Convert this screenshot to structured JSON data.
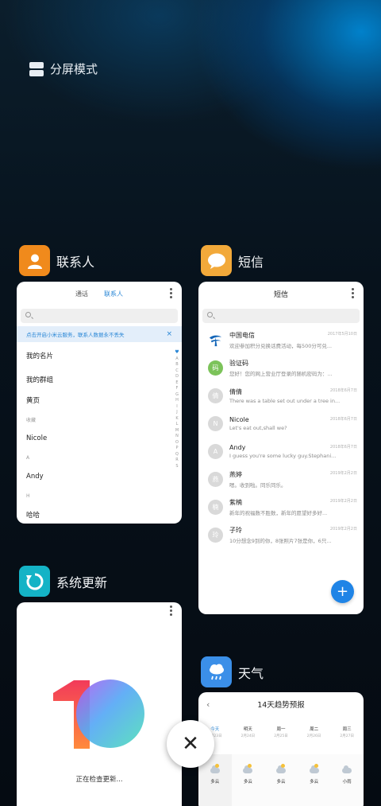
{
  "split_mode": {
    "label": "分屏模式"
  },
  "contacts": {
    "app_name": "联系人",
    "tabs": [
      "通话",
      "联系人"
    ],
    "search_placeholder": "",
    "banner": "点击开启小米云服务，联系人数据永不丢失",
    "banner_close": "×",
    "rows": [
      {
        "type": "item",
        "text": "我的名片"
      },
      {
        "type": "item",
        "text": "我的群组"
      },
      {
        "type": "item",
        "text": "黄页"
      },
      {
        "type": "section",
        "text": "收藏"
      },
      {
        "type": "item",
        "text": "Nicole"
      },
      {
        "type": "section",
        "text": "A"
      },
      {
        "type": "item",
        "text": "Andy"
      },
      {
        "type": "section",
        "text": "H"
      },
      {
        "type": "item",
        "text": "哈哈"
      }
    ],
    "alphabet": [
      "♥",
      "A",
      "B",
      "C",
      "D",
      "E",
      "F",
      "G",
      "H",
      "I",
      "J",
      "K",
      "L",
      "M",
      "N",
      "O",
      "P",
      "Q",
      "R",
      "S"
    ]
  },
  "sms": {
    "app_name": "短信",
    "title": "短信",
    "items": [
      {
        "name": "中国电信",
        "date": "2017年5月10日",
        "preview": "欢迎参加积分兑换话费活动，每500分可兑...",
        "avatar": "telecom"
      },
      {
        "name": "验证码",
        "date": "",
        "preview": "您好！您的网上营业厅登录的随机密码为：...",
        "avatar": "码"
      },
      {
        "name": "倩倩",
        "date": "2018年6月7日",
        "preview": "There was a table set out under a tree in...",
        "avatar": "倩"
      },
      {
        "name": "Nicole",
        "date": "2018年6月7日",
        "preview": "Let's eat out,shall we?",
        "avatar": "N"
      },
      {
        "name": "Andy",
        "date": "2018年6月7日",
        "preview": "I guess you're some lucky guy.Stephani...",
        "avatar": "A"
      },
      {
        "name": "燕婷",
        "date": "2019年2月2日",
        "preview": "嗯。收到啦。同乐同乐。",
        "avatar": "燕"
      },
      {
        "name": "紫楠",
        "date": "2019年2月2日",
        "preview": "新年的祝福数不胜数，新年的愿望好多好...",
        "avatar": "楠"
      },
      {
        "name": "子玲",
        "date": "2019年2月2日",
        "preview": "10分想念9到的你，8张照片7张是你，6只...",
        "avatar": "玲"
      }
    ],
    "fab": "+"
  },
  "update": {
    "app_name": "系统更新",
    "status": "正在检查更新..."
  },
  "weather": {
    "app_name": "天气",
    "title": "14天趋势预报",
    "days": [
      {
        "label": "今天",
        "date": "2月23日",
        "cond": "多云",
        "today": true
      },
      {
        "label": "明天",
        "date": "2月24日",
        "cond": "多云"
      },
      {
        "label": "周一",
        "date": "2月25日",
        "cond": "多云"
      },
      {
        "label": "周二",
        "date": "2月26日",
        "cond": "多云"
      },
      {
        "label": "周三",
        "date": "2月27日",
        "cond": "小雨"
      }
    ]
  },
  "close": {
    "symbol": "✕"
  },
  "colors": {
    "accent": "#2a87d6",
    "contacts_icon": "#f08a1c",
    "sms_icon": "#f2a93a",
    "update_icon": "#14b3c6",
    "weather_icon": "#3b8fe8"
  }
}
